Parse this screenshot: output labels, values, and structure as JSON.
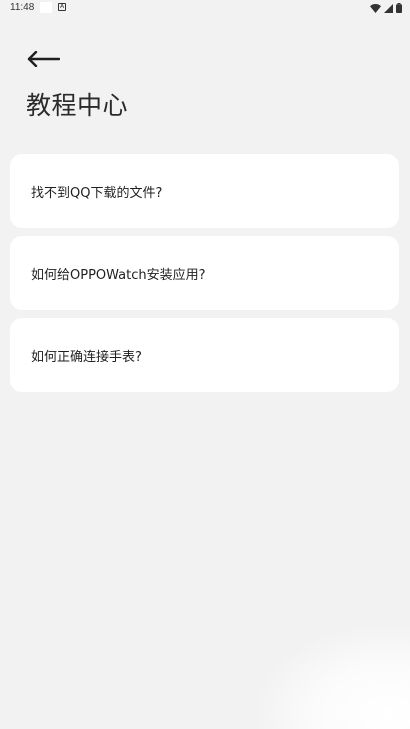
{
  "status_bar": {
    "time": "11:48",
    "notification_icon": "a-box-icon",
    "wifi_icon": "wifi-icon",
    "signal_icon": "signal-icon",
    "battery_icon": "battery-icon"
  },
  "header": {
    "back_icon": "arrow-left-icon",
    "title": "教程中心"
  },
  "tutorials": [
    {
      "label": "找不到QQ下载的文件?"
    },
    {
      "label": "如何给OPPOWatch安装应用?"
    },
    {
      "label": "如何正确连接手表?"
    }
  ]
}
